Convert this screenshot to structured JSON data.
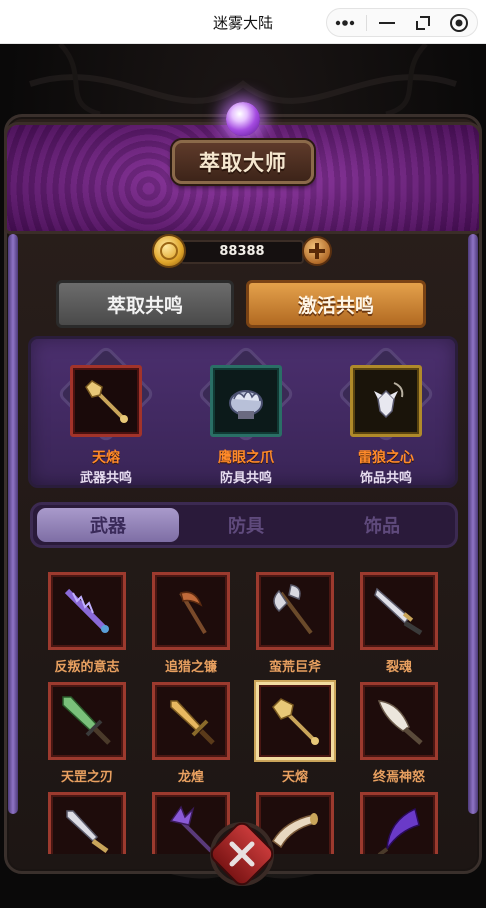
{
  "window": {
    "title": "迷雾大陆",
    "controls": [
      "more-icon",
      "minimize-icon",
      "restore-icon",
      "close-circle-icon"
    ]
  },
  "header": {
    "title": "萃取大师"
  },
  "currency": {
    "amount": "88388",
    "icon": "gold-coin-icon",
    "add_icon": "plus-icon"
  },
  "main_tabs": [
    {
      "label": "萃取共鸣",
      "active": false
    },
    {
      "label": "激活共鸣",
      "active": true
    }
  ],
  "resonance": [
    {
      "name": "天熔",
      "category": "武器共鸣",
      "icon": "mace-icon",
      "frame": "red"
    },
    {
      "name": "鹰眼之爪",
      "category": "防具共鸣",
      "icon": "gauntlet-icon",
      "frame": "teal"
    },
    {
      "name": "雷狼之心",
      "category": "饰品共鸣",
      "icon": "wolf-amulet-icon",
      "frame": "gold"
    }
  ],
  "sub_tabs": [
    {
      "label": "武器",
      "active": true
    },
    {
      "label": "防具",
      "active": false
    },
    {
      "label": "饰品",
      "active": false
    }
  ],
  "items": [
    {
      "name": "反叛的意志",
      "icon": "purple-spike-sword-icon"
    },
    {
      "name": "追猎之镰",
      "icon": "scythe-icon"
    },
    {
      "name": "蛮荒巨斧",
      "icon": "battle-axe-icon"
    },
    {
      "name": "裂魂",
      "icon": "cleaver-sword-icon"
    },
    {
      "name": "天罡之刃",
      "icon": "green-sword-icon"
    },
    {
      "name": "龙煌",
      "icon": "golden-dagger-icon"
    },
    {
      "name": "天熔",
      "icon": "mace-icon",
      "selected": true
    },
    {
      "name": "终焉神怒",
      "icon": "feather-blade-icon"
    },
    {
      "name": "",
      "icon": "short-sword-icon"
    },
    {
      "name": "",
      "icon": "purple-claw-staff-icon"
    },
    {
      "name": "",
      "icon": "horn-icon"
    },
    {
      "name": "",
      "icon": "purple-crescent-blade-icon"
    }
  ],
  "colors": {
    "accent_orange": "#e4a14b",
    "item_label": "#e8a060",
    "resonance_name": "#ff8a2a",
    "panel_purple": "#4b2f6e"
  },
  "close_button": {
    "icon": "close-x-icon"
  }
}
